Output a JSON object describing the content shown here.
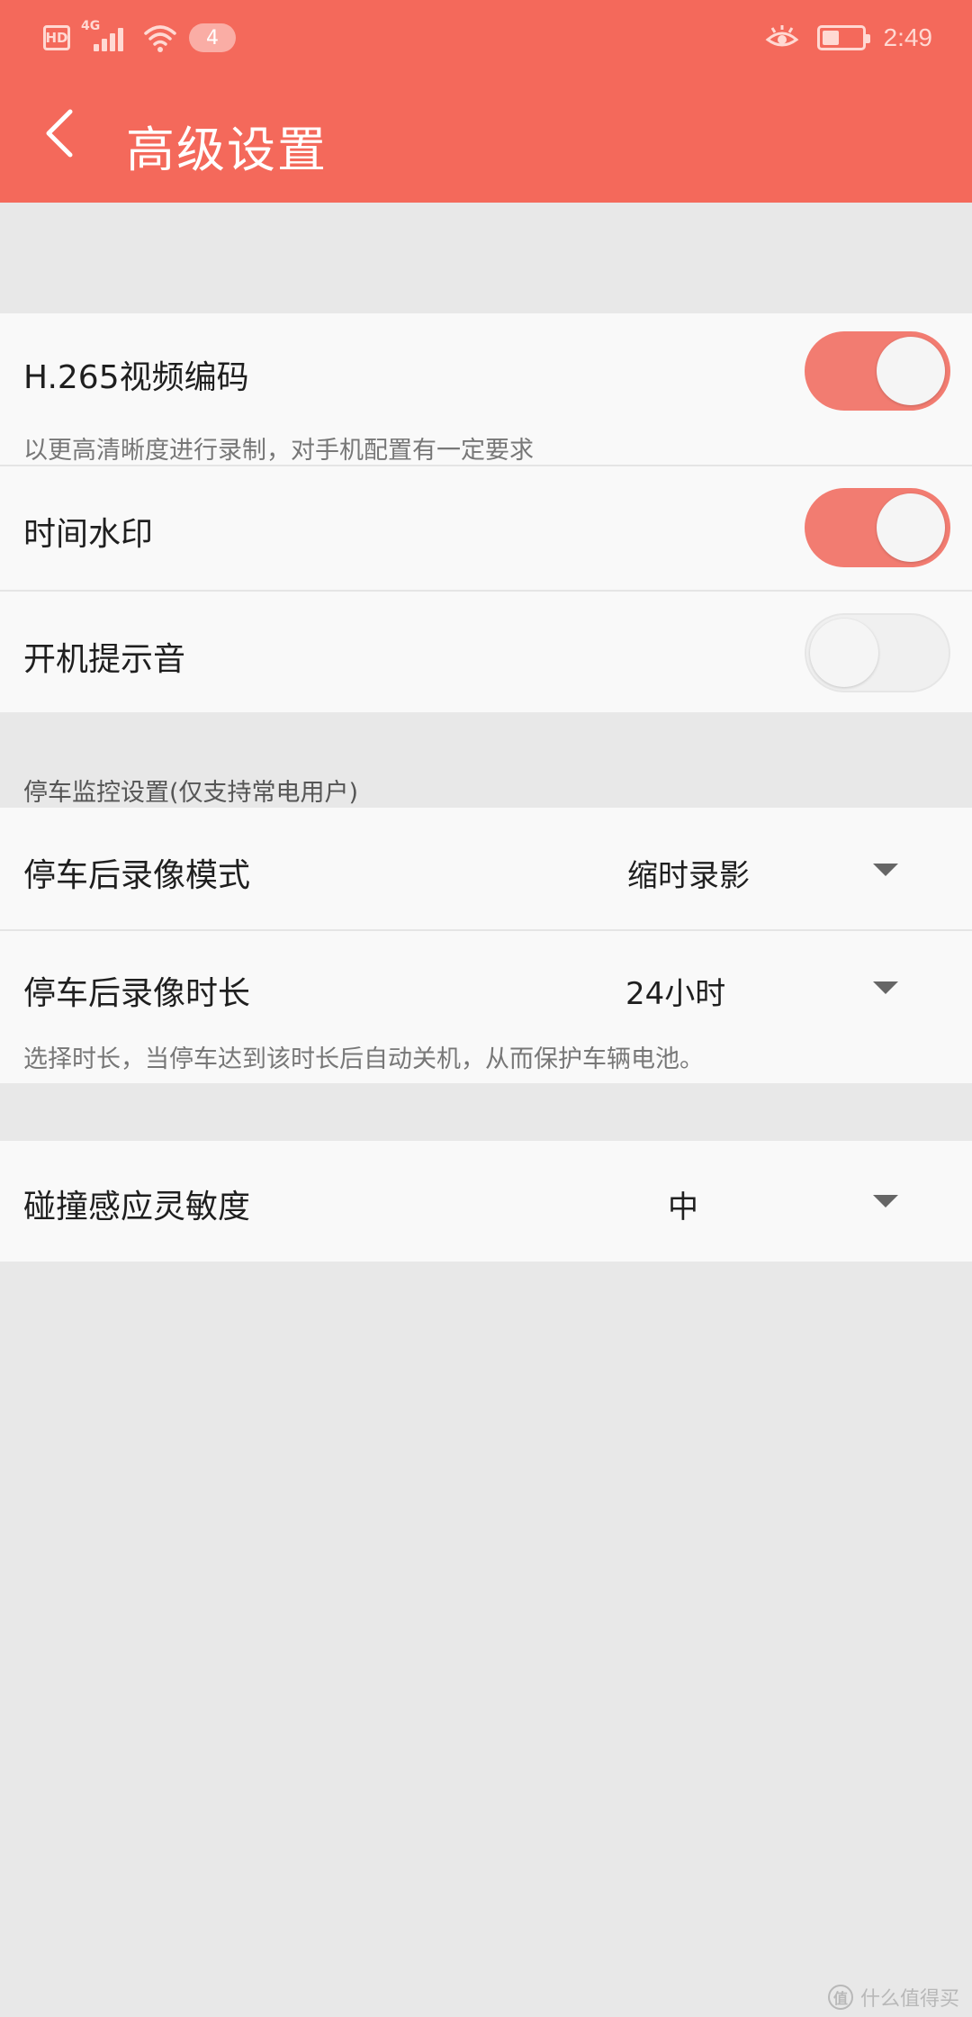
{
  "status_bar": {
    "hd_label": "HD",
    "network_label": "4G",
    "notification_count": "4",
    "time": "2:49",
    "icons": [
      "hd-icon",
      "signal-icon",
      "wifi-icon",
      "eye-care-icon",
      "battery-icon"
    ]
  },
  "app_bar": {
    "title": "高级设置",
    "back_icon": "chevron-left-icon"
  },
  "general_settings": [
    {
      "label": "H.265视频编码",
      "description": "以更高清晰度进行录制，对手机配置有一定要求",
      "enabled": true
    },
    {
      "label": "时间水印",
      "enabled": true
    },
    {
      "label": "开机提示音",
      "enabled": false
    }
  ],
  "parking": {
    "header": "停车监控设置(仅支持常电用户)",
    "mode": {
      "label": "停车后录像模式",
      "value": "缩时录影"
    },
    "duration": {
      "label": "停车后录像时长",
      "value": "24小时",
      "description": "选择时长，当停车达到该时长后自动关机，从而保护车辆电池。"
    }
  },
  "collision": {
    "label": "碰撞感应灵敏度",
    "value": "中"
  },
  "watermark": {
    "text": "什么值得买",
    "icon_text": "值"
  },
  "colors": {
    "accent": "#f4695b",
    "toggle_on": "#f27c71",
    "background": "#e8e8e8",
    "card": "#f9f9f9"
  }
}
